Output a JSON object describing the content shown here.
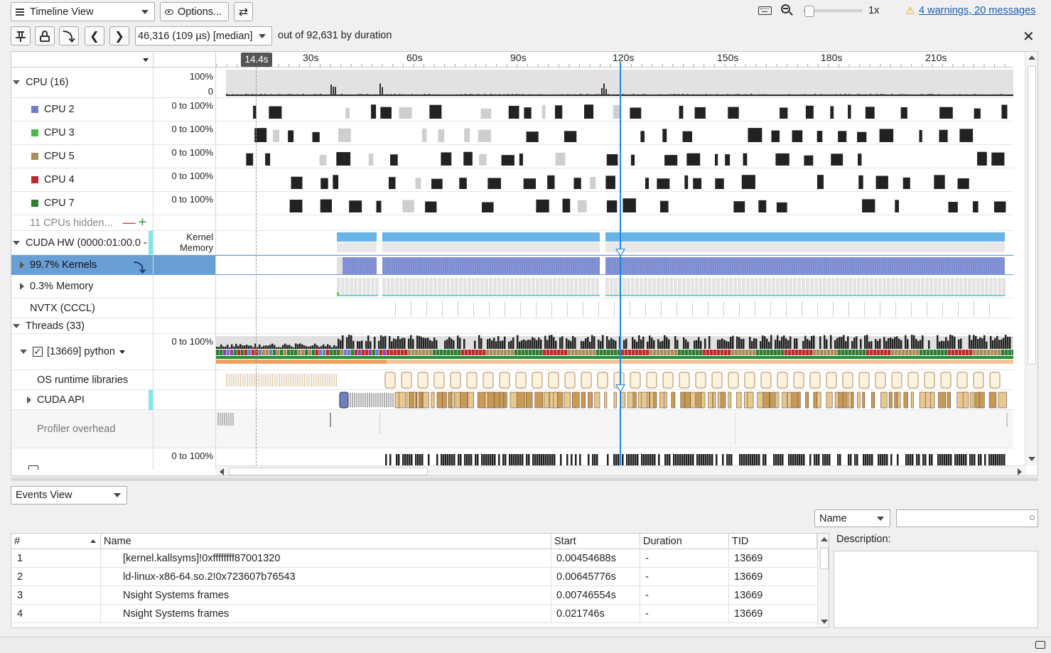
{
  "toolbar": {
    "view_selector": "Timeline View",
    "options_label": "Options...",
    "zoom_level": "1x",
    "warnings_link": "4 warnings, 20 messages",
    "event_combo": "46,316 (109 µs) [median]",
    "event_count_text": "out of 92,631 by duration"
  },
  "ruler": {
    "cursor_label": "14.4s",
    "ticks": [
      "30s",
      "60s",
      "90s",
      "120s",
      "150s",
      "180s",
      "210s"
    ]
  },
  "tree": {
    "cpu_group": "CPU (16)",
    "cpu_scale_top": "100%",
    "cpu_scale_bottom": "0",
    "cpus": [
      {
        "name": "CPU 2",
        "range": "0 to 100%",
        "color": "#6f7fc4"
      },
      {
        "name": "CPU 3",
        "range": "0 to 100%",
        "color": "#4cb848"
      },
      {
        "name": "CPU 5",
        "range": "0 to 100%",
        "color": "#a88c5a"
      },
      {
        "name": "CPU 4",
        "range": "0 to 100%",
        "color": "#c0282c"
      },
      {
        "name": "CPU 7",
        "range": "0 to 100%",
        "color": "#2e7d32"
      }
    ],
    "hidden_cpus": "11 CPUs hidden...",
    "cuda_hw": "CUDA HW (0000:01:00.0 - |",
    "cuda_hw_label_1": "Kernel",
    "cuda_hw_label_2": "Memory",
    "kernels": "99.7% Kernels",
    "memory": "0.3% Memory",
    "nvtx": "NVTX (CCCL)",
    "threads_group": "Threads (33)",
    "python_thread": "[13669] python",
    "python_range": "0 to 100%",
    "os_runtime": "OS runtime libraries",
    "cuda_api": "CUDA API",
    "profiler_overhead": "Profiler overhead",
    "next_thread_range": "0 to 100%"
  },
  "events": {
    "view_selector": "Events View",
    "filter_field": "Name",
    "search_placeholder": "",
    "description_label": "Description:",
    "columns": [
      "#",
      "Name",
      "Start",
      "Duration",
      "TID"
    ],
    "rows": [
      {
        "n": "1",
        "name": "[kernel.kallsyms]!0xffffffff87001320",
        "start": "0.00454688s",
        "duration": "-",
        "tid": "13669"
      },
      {
        "n": "2",
        "name": "ld-linux-x86-64.so.2!0x723607b76543",
        "start": "0.00645776s",
        "duration": "-",
        "tid": "13669"
      },
      {
        "n": "3",
        "name": "Nsight Systems frames",
        "start": "0.00746554s",
        "duration": "-",
        "tid": "13669"
      },
      {
        "n": "4",
        "name": "Nsight Systems frames",
        "start": "0.021746s",
        "duration": "-",
        "tid": "13669"
      }
    ]
  },
  "colors": {
    "kernel_bar": "#7b8bd0",
    "kernel_top": "#6bb4e8",
    "cursor_line": "#1e88e5",
    "selected_row": "#6a9fd6"
  }
}
